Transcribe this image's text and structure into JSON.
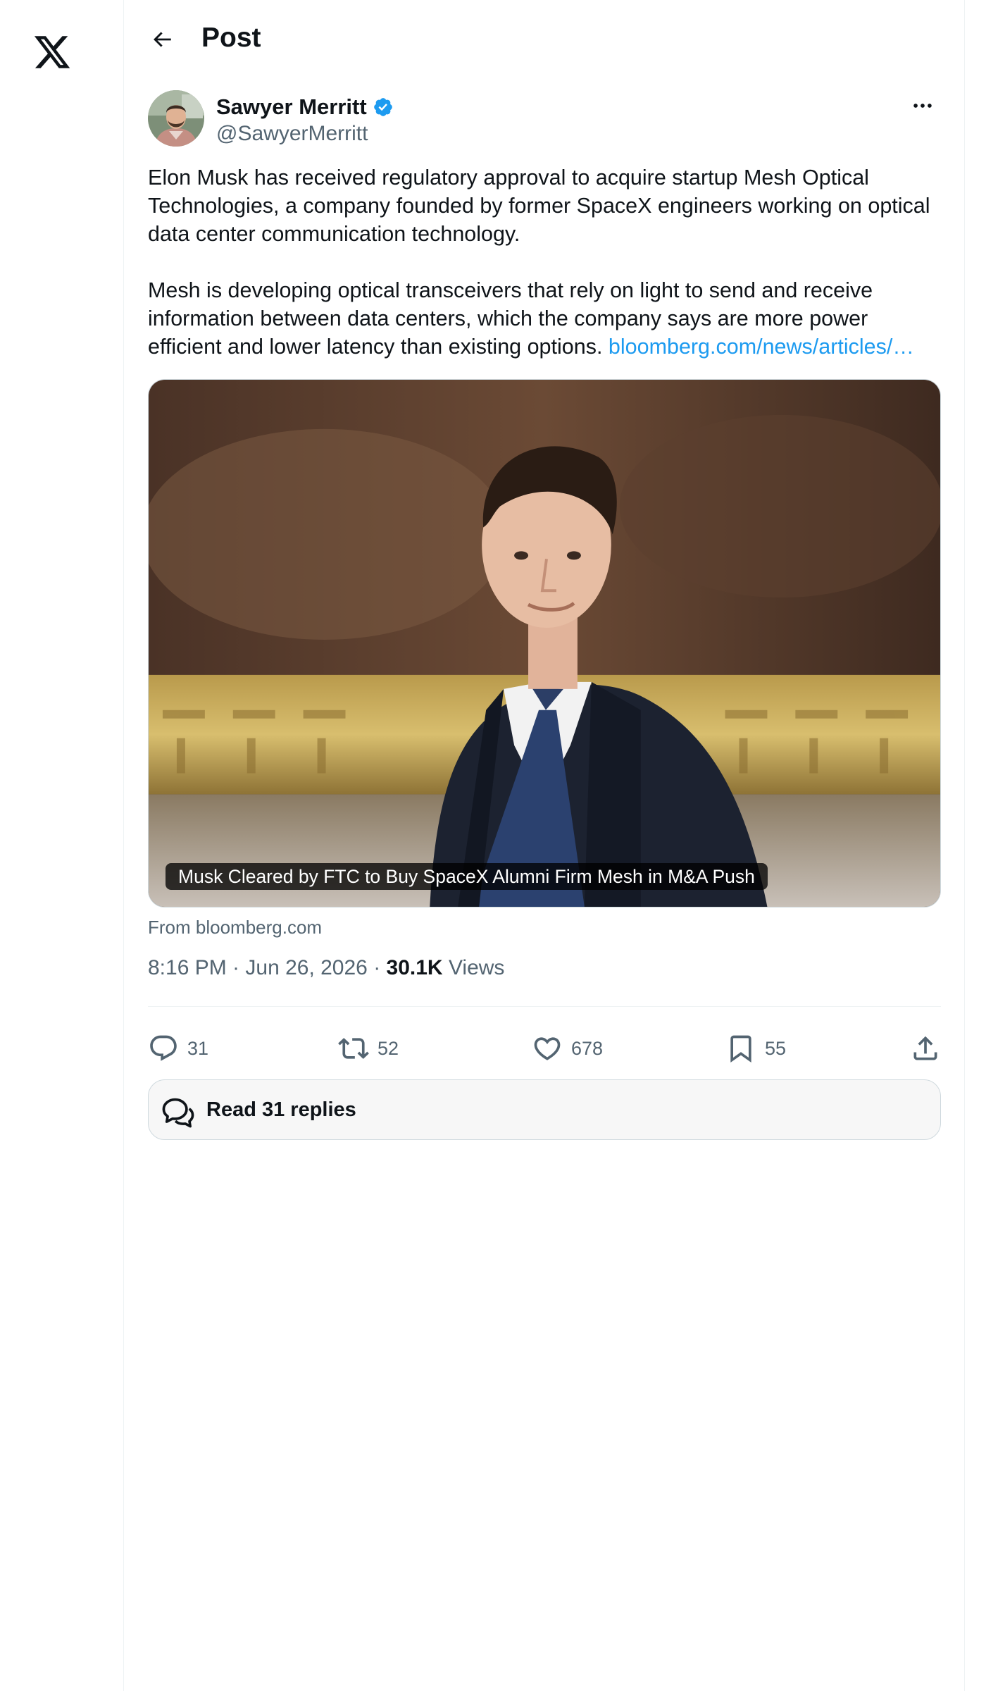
{
  "nav": {
    "logo_icon": "x-logo-icon"
  },
  "header": {
    "title": "Post",
    "back_icon": "arrow-left-icon"
  },
  "post": {
    "author": {
      "name": "Sawyer Merritt",
      "handle": "@SawyerMerritt",
      "verified": true,
      "verified_icon": "verified-badge-icon"
    },
    "more_icon": "more-horizontal-icon",
    "text_paragraph_1": "Elon Musk has received regulatory approval to acquire startup Mesh Optical Technologies, a company founded by former SpaceX engineers working on optical data center communication technology.",
    "text_paragraph_2": "Mesh is developing optical transceivers that rely on light to send and receive information between data centers, which the company says are more power efficient and lower latency than existing options.",
    "link_text": "bloomberg.com/news/articles/…",
    "card": {
      "caption": "Musk Cleared by FTC to Buy SpaceX Alumni Firm Mesh in M&A Push",
      "source": "From bloomberg.com"
    },
    "timestamp": "8:16 PM · Jun 26, 2026",
    "separator": " · ",
    "views_count": "30.1K",
    "views_label": "Views",
    "actions": {
      "replies": {
        "count": "31",
        "icon": "reply-icon"
      },
      "reposts": {
        "count": "52",
        "icon": "repost-icon"
      },
      "likes": {
        "count": "678",
        "icon": "heart-icon"
      },
      "bookmarks": {
        "count": "55",
        "icon": "bookmark-icon"
      },
      "share": {
        "icon": "share-icon"
      }
    },
    "read_replies_label": "Read 31 replies"
  },
  "colors": {
    "accent": "#1d9bf0",
    "text_primary": "#0f1419",
    "text_secondary": "#536471",
    "border": "#cfd9de"
  }
}
